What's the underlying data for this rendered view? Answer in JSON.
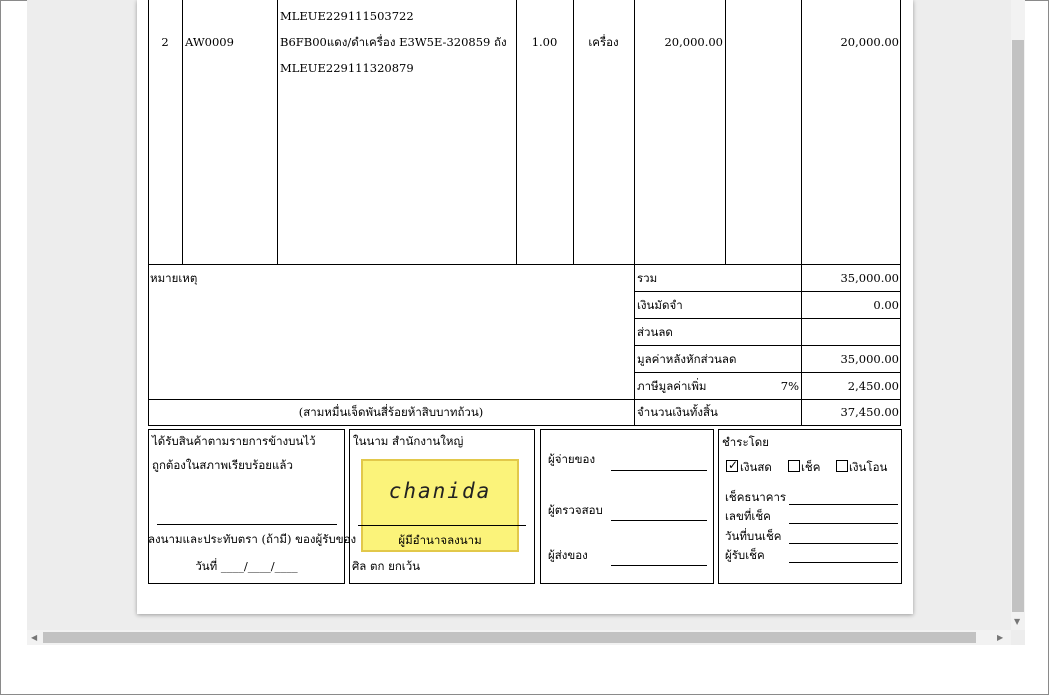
{
  "items": [
    {
      "line1": "MLEUE229111503722",
      "no": "2",
      "code": "AW0009",
      "line2": "B6FB00แดง/ดำเครื่อง E3W5E-320859 ถัง",
      "line3": "MLEUE229111320879",
      "qty": "1.00",
      "unit": "เครื่อง",
      "price": "20,000.00",
      "discount": "",
      "amount": "20,000.00"
    }
  ],
  "remarks_label": "หมายเหตุ",
  "amount_in_words": "(สามหมื่นเจ็ดพันสี่ร้อยห้าสิบบาทถ้วน)",
  "totals": {
    "subtotal_label": "รวม",
    "subtotal": "35,000.00",
    "deposit_label": "เงินมัดจำ",
    "deposit": "0.00",
    "discount_label": "ส่วนลด",
    "discount": "",
    "after_discount_label": "มูลค่าหลังหักส่วนลด",
    "after_discount": "35,000.00",
    "vat_label": "ภาษีมูลค่าเพิ่ม",
    "vat_rate": "7%",
    "vat": "2,450.00",
    "grand_total_label": "จำนวนเงินทั้งสิ้น",
    "grand_total": "37,450.00"
  },
  "receiver": {
    "line1": "ได้รับสินค้าตามรายการข้างบนไว้",
    "line2": "ถูกต้องในสภาพเรียบร้อยแล้ว",
    "sign_label": "ลงนามและประทับตรา (ถ้ามี) ของผู้รับของ",
    "date_label": "วันที่ ____/____/____"
  },
  "company": {
    "on_behalf": "ในนาม สำนักงานใหญ่",
    "signature": "chanida",
    "authorized_label": "ผู้มีอำนาจลงนาม",
    "note": "ศิล ตก ยกเว้น"
  },
  "signers": {
    "payer": "ผู้จ่ายของ",
    "checker": "ผู้ตรวจสอบ",
    "deliverer": "ผู้ส่งของ"
  },
  "payment": {
    "title": "ชำระโดย",
    "cash": "เงินสด",
    "cash_checked": true,
    "cheque": "เช็ค",
    "transfer": "เงินโอน",
    "bank_label": "เช็คธนาคาร",
    "cheque_no_label": "เลขที่เช็ค",
    "cheque_date_label": "วันที่บนเช็ค",
    "cheque_receiver_label": "ผู้รับเช็ค"
  },
  "colors": {
    "stamp_fill": "#fbf37a",
    "viewer_bg": "#ededed"
  }
}
